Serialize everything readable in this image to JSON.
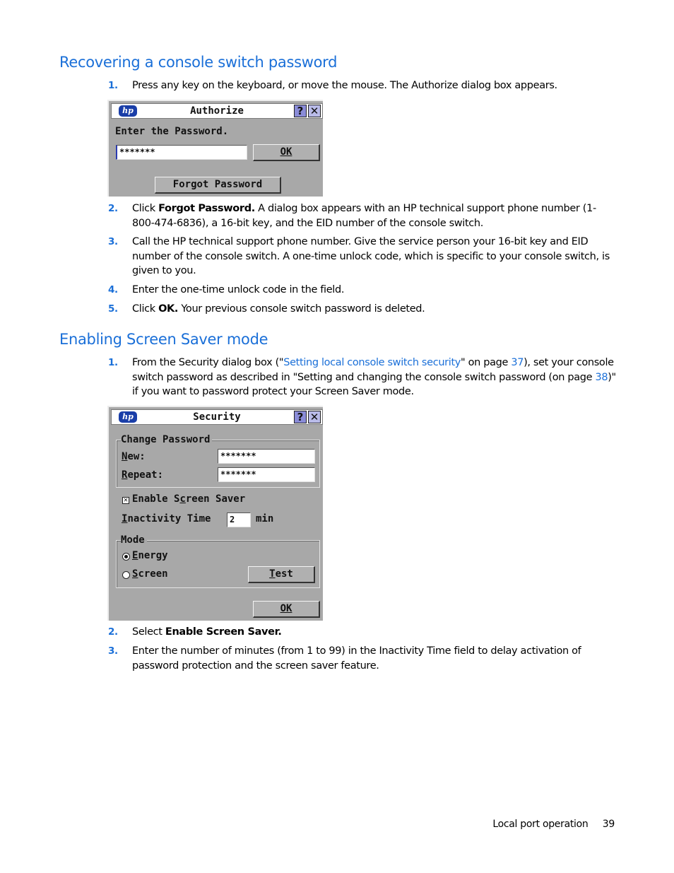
{
  "section1": {
    "heading": "Recovering a console switch password",
    "steps": [
      {
        "num": "1.",
        "text": "Press any key on the keyboard, or move the mouse. The Authorize dialog box appears."
      },
      {
        "num": "2.",
        "pre": "Click ",
        "bold": "Forgot Password.",
        "post": " A dialog box appears with an HP technical support phone number (1-800-474-6836), a 16-bit key, and the EID number of the console switch."
      },
      {
        "num": "3.",
        "text": "Call the HP technical support phone number. Give the service person your 16-bit key and EID number of the console switch. A one-time unlock code, which is specific to your console switch, is given to you."
      },
      {
        "num": "4.",
        "text": "Enter the one-time unlock code in the field."
      },
      {
        "num": "5.",
        "pre": "Click ",
        "bold": "OK.",
        "post": " Your previous console switch password is deleted."
      }
    ]
  },
  "authorize_dialog": {
    "logo": "hp",
    "title": "Authorize",
    "help_label": "?",
    "close_label": "✕",
    "prompt": "Enter the Password.",
    "password_value": "*******",
    "ok_label": "OK",
    "forgot_label": "Forgot Password"
  },
  "section2": {
    "heading": "Enabling Screen Saver mode",
    "step1": {
      "num": "1.",
      "t1": "From the Security dialog box (\"",
      "link1": "Setting local console switch security",
      "t2": "\" on page ",
      "link2": "37",
      "t3": "), set your console switch password as described in \"Setting and changing the console switch password (on page ",
      "link3": "38",
      "t4": ")\" if you want to password protect your Screen Saver mode."
    },
    "step2": {
      "num": "2.",
      "pre": "Select ",
      "bold": "Enable Screen Saver."
    },
    "step3": {
      "num": "3.",
      "text": "Enter the number of minutes (from 1 to 99) in the Inactivity Time field to delay activation of password protection and the screen saver feature."
    }
  },
  "security_dialog": {
    "logo": "hp",
    "title": "Security",
    "help_label": "?",
    "close_label": "✕",
    "change_password_group": "Change Password",
    "new_label": "New:",
    "new_value": "*******",
    "repeat_label": "Repeat:",
    "repeat_value": "*******",
    "enable_screen_saver_label": "Enable Screen Saver",
    "enable_screen_saver_checked": true,
    "inactivity_label": "Inactivity Time",
    "inactivity_value": "2",
    "inactivity_unit": "min",
    "mode_group": "Mode",
    "mode_options": [
      {
        "label": "Energy",
        "selected": true
      },
      {
        "label": "Screen",
        "selected": false
      }
    ],
    "test_label": "Test",
    "ok_label": "OK"
  },
  "footer": {
    "section": "Local port operation",
    "page": "39"
  }
}
